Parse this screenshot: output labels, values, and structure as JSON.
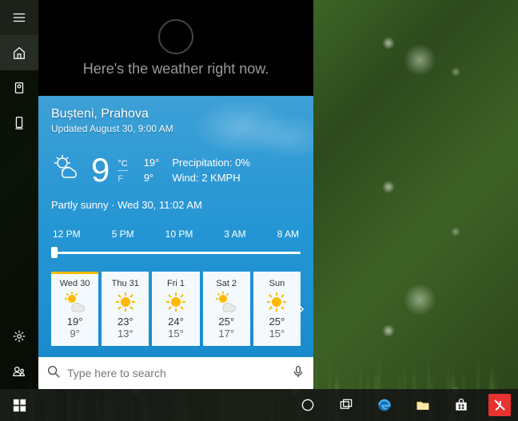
{
  "cortana": {
    "message": "Here's the weather right now."
  },
  "weather": {
    "location": "Bușteni, Prahova",
    "updated": "Updated August 30, 9:00 AM",
    "temp": "9",
    "unit_c": "°C",
    "unit_f": "F",
    "high": "19°",
    "low": "9°",
    "precip": "Precipitation: 0%",
    "wind": "Wind: 2 KMPH",
    "condition": "Partly sunny",
    "time": "Wed 30, 11:02 AM",
    "hours": [
      "12 PM",
      "5 PM",
      "10 PM",
      "3 AM",
      "8 AM"
    ],
    "forecast": [
      {
        "day": "Wed 30",
        "hi": "19°",
        "lo": "9°",
        "icon": "partly"
      },
      {
        "day": "Thu 31",
        "hi": "23°",
        "lo": "13°",
        "icon": "sunny"
      },
      {
        "day": "Fri 1",
        "hi": "24°",
        "lo": "15°",
        "icon": "sunny"
      },
      {
        "day": "Sat 2",
        "hi": "25°",
        "lo": "17°",
        "icon": "partly"
      },
      {
        "day": "Sun",
        "hi": "25°",
        "lo": "15°",
        "icon": "sunny"
      }
    ]
  },
  "search": {
    "placeholder": "Type here to search"
  }
}
